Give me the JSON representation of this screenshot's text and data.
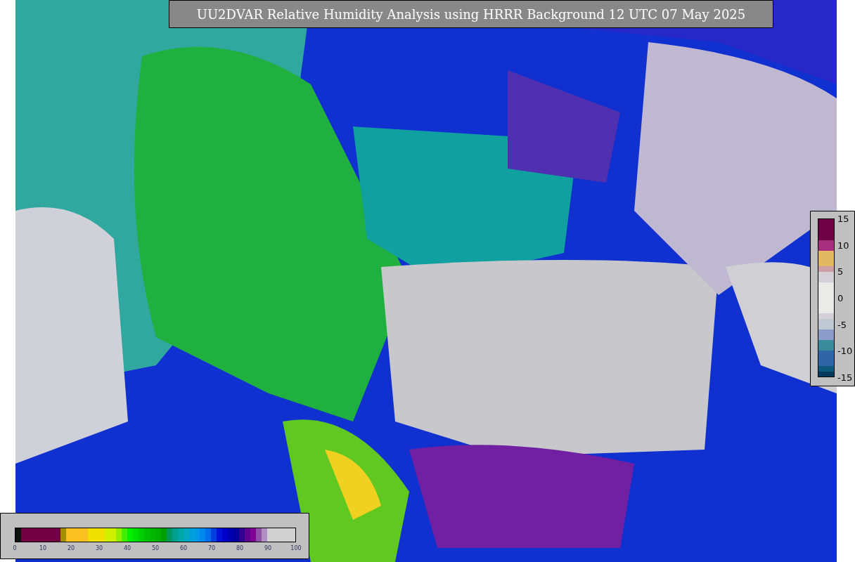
{
  "title": "UU2DVAR Relative Humidity Analysis using HRRR Background 12 UTC 07 May 2025",
  "increment_legend": {
    "ticks": [
      "15",
      "10",
      "5",
      "0",
      "-5",
      "-10",
      "-15"
    ],
    "segments": [
      {
        "color": "#6e0046"
      },
      {
        "color": "#6e0046"
      },
      {
        "color": "#6e0046"
      },
      {
        "color": "#6e0046"
      },
      {
        "color": "#a6307e"
      },
      {
        "color": "#a6307e"
      },
      {
        "color": "#e2b862"
      },
      {
        "color": "#e2b862"
      },
      {
        "color": "#e2b862"
      },
      {
        "color": "#cc9ea8"
      },
      {
        "color": "#d4d0d8"
      },
      {
        "color": "#d4d0d8"
      },
      {
        "color": "#eaeae6"
      },
      {
        "color": "#eaeae6"
      },
      {
        "color": "#eaeae6"
      },
      {
        "color": "#eaeae6"
      },
      {
        "color": "#eaeae6"
      },
      {
        "color": "#eaeae6"
      },
      {
        "color": "#d4d0d8"
      },
      {
        "color": "#c0c8d4"
      },
      {
        "color": "#c0c8d4"
      },
      {
        "color": "#8c9cc8"
      },
      {
        "color": "#8c9cc8"
      },
      {
        "color": "#3a8c9c"
      },
      {
        "color": "#3a8c9c"
      },
      {
        "color": "#3066a8"
      },
      {
        "color": "#3066a8"
      },
      {
        "color": "#3066a8"
      },
      {
        "color": "#0c5a7c"
      },
      {
        "color": "#063a5c"
      }
    ]
  },
  "humidity_legend": {
    "ticks": [
      "0",
      "10",
      "20",
      "30",
      "40",
      "50",
      "60",
      "70",
      "80",
      "90",
      "100"
    ],
    "segments": [
      {
        "color": "#101010"
      },
      {
        "color": "#700040"
      },
      {
        "color": "#700040"
      },
      {
        "color": "#700040"
      },
      {
        "color": "#700040"
      },
      {
        "color": "#700040"
      },
      {
        "color": "#700040"
      },
      {
        "color": "#700040"
      },
      {
        "color": "#a09000"
      },
      {
        "color": "#f8c020"
      },
      {
        "color": "#f8c020"
      },
      {
        "color": "#f8c020"
      },
      {
        "color": "#f8c020"
      },
      {
        "color": "#f0e000"
      },
      {
        "color": "#f0e000"
      },
      {
        "color": "#f0e000"
      },
      {
        "color": "#d0f000"
      },
      {
        "color": "#d0f000"
      },
      {
        "color": "#90f000"
      },
      {
        "color": "#40f000"
      },
      {
        "color": "#00f000"
      },
      {
        "color": "#00e000"
      },
      {
        "color": "#00d000"
      },
      {
        "color": "#00c000"
      },
      {
        "color": "#00b800"
      },
      {
        "color": "#00b000"
      },
      {
        "color": "#00a000"
      },
      {
        "color": "#009860"
      },
      {
        "color": "#00a090"
      },
      {
        "color": "#00a8a8"
      },
      {
        "color": "#00a8c0"
      },
      {
        "color": "#00a0d8"
      },
      {
        "color": "#0098e8"
      },
      {
        "color": "#0088f0"
      },
      {
        "color": "#0070f0"
      },
      {
        "color": "#0040e0"
      },
      {
        "color": "#0010d8"
      },
      {
        "color": "#0000c8"
      },
      {
        "color": "#0000b0"
      },
      {
        "color": "#0000a0"
      },
      {
        "color": "#300090"
      },
      {
        "color": "#600090"
      },
      {
        "color": "#800090"
      },
      {
        "color": "#9050a8"
      },
      {
        "color": "#b090c0"
      },
      {
        "color": "#d0d0d0"
      },
      {
        "color": "#d0d0d0"
      },
      {
        "color": "#d0d0d0"
      },
      {
        "color": "#d0d0d0"
      },
      {
        "color": "#d0d0d0"
      }
    ]
  }
}
